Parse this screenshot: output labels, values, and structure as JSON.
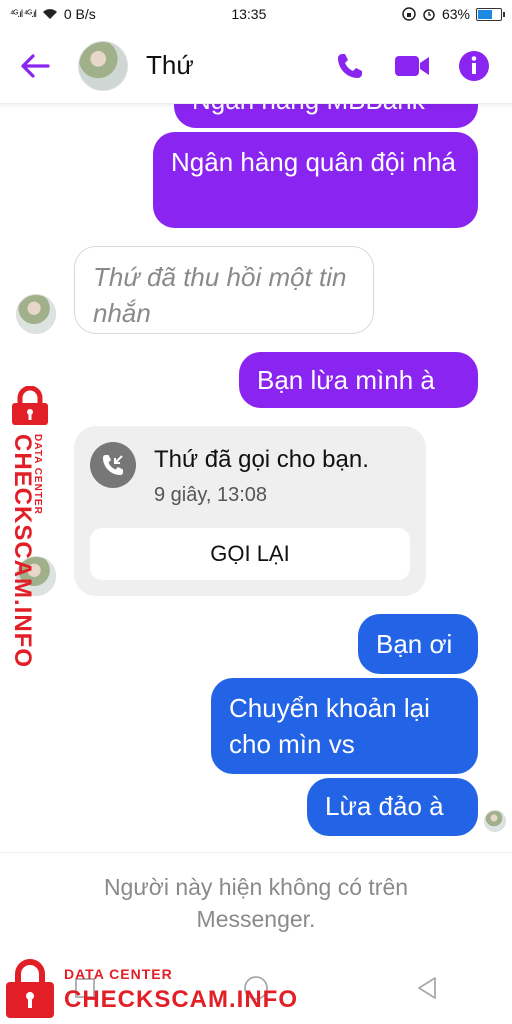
{
  "status_bar": {
    "signal": "⁴ᴳ.ıl ⁴ᴳ.ıl",
    "speed": "0 B/s",
    "time": "13:35",
    "battery": "63%",
    "battery_level": 0.63
  },
  "header": {
    "name": "Thứ",
    "accent_color": "#8a24f0"
  },
  "messages": [
    {
      "type": "outgoing",
      "style": "purple",
      "text": "Ngân hàng MBBank"
    },
    {
      "type": "outgoing",
      "style": "purple",
      "text": "Ngân hàng quân đội nhá"
    },
    {
      "type": "incoming",
      "style": "recalled",
      "text": "Thứ đã thu hồi một tin nhắn"
    },
    {
      "type": "outgoing",
      "style": "purple",
      "text": "Bạn lừa mình à"
    },
    {
      "type": "outgoing",
      "style": "blue",
      "text": "Bạn ơi"
    },
    {
      "type": "outgoing",
      "style": "blue",
      "text": "Chuyển khoản lại cho mìn vs"
    },
    {
      "type": "outgoing",
      "style": "blue",
      "text": "Lừa đảo à"
    }
  ],
  "call_card": {
    "title": "Thứ đã gọi cho bạn.",
    "time": "9 giây, 13:08",
    "button": "GỌI LẠI"
  },
  "footer": {
    "notice": "Người này hiện không có trên Messenger."
  },
  "watermark": {
    "sub": "DATA CENTER",
    "text": "CHECKSCAM.INFO",
    "color": "#e21e26"
  }
}
